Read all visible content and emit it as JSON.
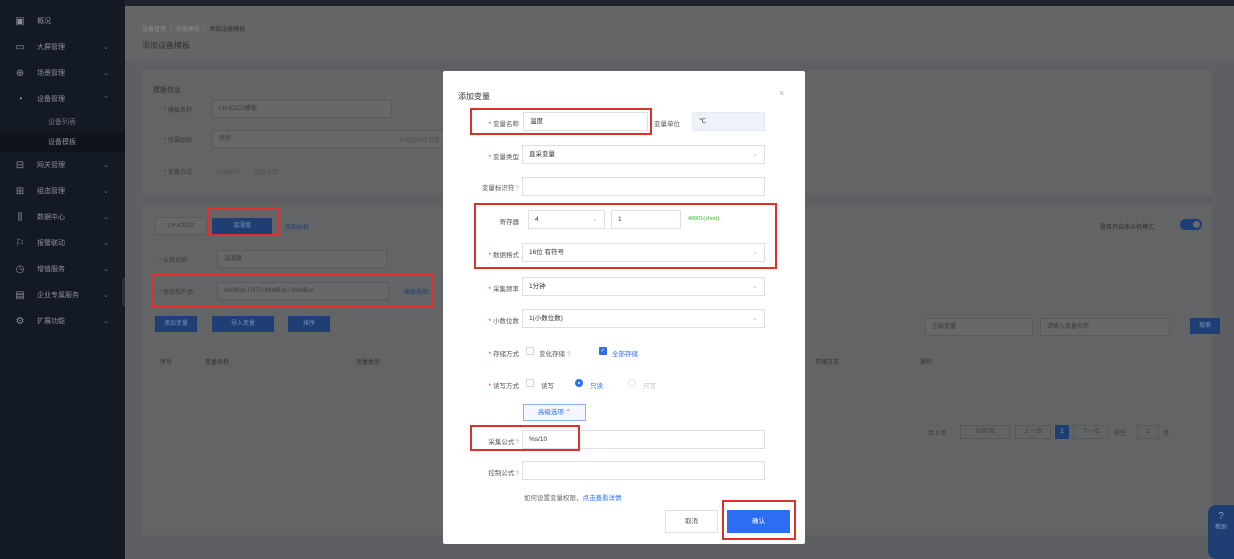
{
  "sidebar": {
    "items": [
      {
        "icon": "overview-icon",
        "glyph": "▣",
        "label": "概况",
        "chev": ""
      },
      {
        "icon": "screen-icon",
        "glyph": "▭",
        "label": "大屏管理",
        "chev": "⌄"
      },
      {
        "icon": "scene-icon",
        "glyph": "⊕",
        "label": "场景管理",
        "chev": "⌄"
      },
      {
        "icon": "device-icon",
        "glyph": "◔",
        "label": "设备管理",
        "chev": "⌃"
      },
      {
        "icon": "grid-icon",
        "glyph": "⊟",
        "label": "网关管理",
        "chev": "⌄"
      },
      {
        "icon": "group-icon",
        "glyph": "⊞",
        "label": "组态管理",
        "chev": "⌄"
      },
      {
        "icon": "data-icon",
        "glyph": "⫼",
        "label": "数据中心",
        "chev": "⌄"
      },
      {
        "icon": "alarm-icon",
        "glyph": "⚐",
        "label": "报警联动",
        "chev": "⌄"
      },
      {
        "icon": "clock-icon",
        "glyph": "◷",
        "label": "增值服务",
        "chev": "⌄"
      },
      {
        "icon": "enterprise-icon",
        "glyph": "▤",
        "label": "企业专属服务",
        "chev": "⌄"
      },
      {
        "icon": "extend-icon",
        "glyph": "⚙",
        "label": "扩展功能",
        "chev": "⌄"
      }
    ],
    "sub_items": [
      "设备列表",
      "设备模板"
    ]
  },
  "breadcrumb": [
    "设备管理",
    "/",
    "设备模板",
    "/",
    "添加设备模板"
  ],
  "page_title": "添加设备模板",
  "background": {
    "section_title": "模板信息",
    "template_name_label": "* 模板名称",
    "template_name_value": "LH-IO222模板",
    "org_label": "* 所属组织",
    "org_value": "南宫",
    "org_hint": "下级组织可查看",
    "collect_label": "* 采集方式",
    "collect_opt1": "云端轮询",
    "collect_opt2": "边缘计算",
    "device_tab": "LH-IO222",
    "slave_tab": "温湿度",
    "add_slave": "添加从机",
    "slave_name_label": "* 从机名称",
    "slave_name_value": "温湿度",
    "protocol_label": "* 协议和产品",
    "protocol_value": "ModBus / RTU ModBus / ModBus",
    "protocol_link": "高级选项",
    "btn_add_var": "添加变量",
    "btn_import": "导入变量",
    "btn_sort": "排序",
    "multi_slave_label": "是否开启多从机模式",
    "filter_select": "全部变量",
    "filter_search": "请输入变量名称",
    "btn_search": "搜索",
    "col_no": "序号",
    "col_name": "变量名称",
    "col_type": "变量类型",
    "col_store": "存储方式",
    "col_op": "操作",
    "pager_total": "共 0 条",
    "pager_size": "10条/页",
    "pager_prev": "上一页",
    "pager_cur": "1",
    "pager_next": "下一页",
    "pager_goto": "前往",
    "pager_goto_val": "1",
    "pager_page": "页"
  },
  "help_fab": {
    "icon": "help-icon",
    "label": "帮助"
  },
  "modal": {
    "title": "添加变量",
    "close": "×",
    "var_name_label": "变量名称",
    "var_name_value": "温度",
    "unit_label": "变量单位",
    "unit_value": "℃",
    "var_type_label": "变量类型",
    "var_type_value": "直采变量",
    "identifier_label": "变量标识符",
    "identifier_value": "",
    "register_label": "寄存器",
    "register_type": "4",
    "register_addr": "1",
    "register_hint": "40001(short)",
    "data_format_label": "数据格式",
    "data_format_value": "16位 有符号",
    "freq_label": "采集频率",
    "freq_value": "1分钟",
    "decimals_label": "小数位数",
    "decimals_value": "1(小数位数)",
    "storage_label": "存储方式",
    "storage_opt1": "变化存储",
    "storage_opt2": "全部存储",
    "rw_label": "读写方式",
    "rw_opt1": "读写",
    "rw_opt2": "只读",
    "rw_opt3": "只写",
    "advanced": "高级选项 ⌃",
    "collect_formula_label": "采集公式",
    "collect_formula_value": "%s/10",
    "control_formula_label": "控制公式",
    "control_formula_value": "",
    "tip_text": "如何设置变量权限，",
    "tip_link": "点击查看详情",
    "cancel": "取消",
    "confirm": "确认"
  }
}
